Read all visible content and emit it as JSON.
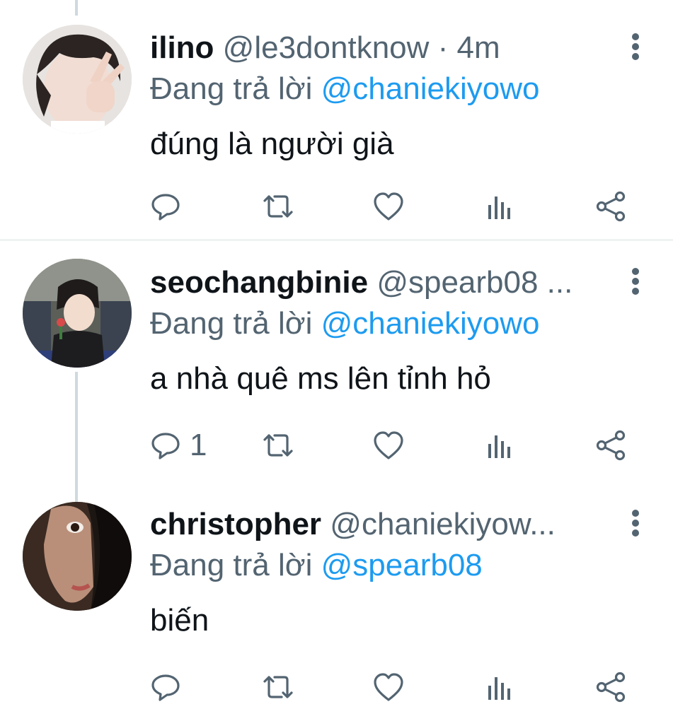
{
  "tweets": [
    {
      "display_name": "ilino",
      "handle": "@le3dontknow",
      "separator": "·",
      "time": "4m",
      "reply_prefix": "Đang trả lời",
      "reply_to": "@chaniekiyowo",
      "text": "đúng là người già",
      "reply_count": ""
    },
    {
      "display_name": "seochangbinie",
      "handle": "@spearb08 ...",
      "separator": "",
      "time": "",
      "reply_prefix": "Đang trả lời",
      "reply_to": "@chaniekiyowo",
      "text": "a nhà quê ms lên tỉnh hỏ",
      "reply_count": "1"
    },
    {
      "display_name": "christopher",
      "handle": "@chaniekiyow...",
      "separator": "",
      "time": "",
      "reply_prefix": "Đang trả lời",
      "reply_to": "@spearb08",
      "text": "biến",
      "reply_count": ""
    }
  ],
  "icons": {
    "more": "more-vertical-icon",
    "reply": "reply-icon",
    "retweet": "retweet-icon",
    "like": "heart-icon",
    "views": "views-bar-chart-icon",
    "share": "share-icon"
  },
  "colors": {
    "text": "#0f1419",
    "secondary": "#536471",
    "link": "#1d9bf0",
    "divider": "#eff3f4",
    "thread_line": "#cfd9de"
  }
}
